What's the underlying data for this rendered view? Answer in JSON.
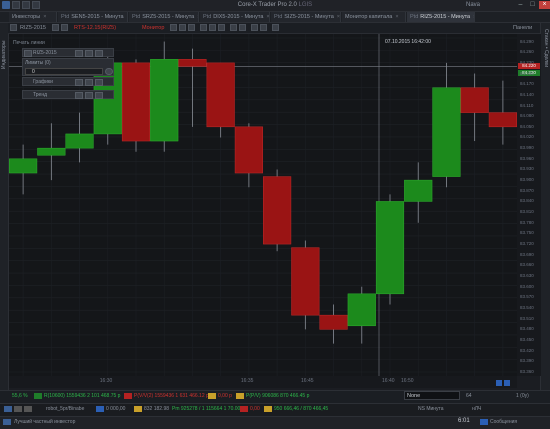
{
  "window": {
    "title": "Core-X Trader Pro 2.0",
    "version": "LGIS",
    "user": "Nava"
  },
  "tabs": [
    {
      "label": "Инвесторы",
      "prefix": "",
      "active": false
    },
    {
      "label": "SEN5-2015 - Минута",
      "prefix": "Ptd",
      "active": false
    },
    {
      "label": "SRZ5-2015 - Минута",
      "prefix": "Ptd",
      "active": false
    },
    {
      "label": "DIX5-2015 - Минута",
      "prefix": "Ptd",
      "active": false
    },
    {
      "label": "SIZ5-2015 - Минута",
      "prefix": "Ptd",
      "active": false
    },
    {
      "label": "Монитор капитала",
      "prefix": "",
      "active": false
    },
    {
      "label": "RIZ5-2015 - Минута",
      "prefix": "Ptd",
      "active": true
    }
  ],
  "toolbar": {
    "symbol": "RIZ5-2015",
    "timeframe": "Минута",
    "red_item_1": "RTS-12.15(RIZ5)",
    "red_item_2": "Монитор",
    "right_label": "Панели"
  },
  "sidebar": {
    "left_label": "Индикаторы",
    "right_label": "Стакан • Сделки"
  },
  "chart_overlay": {
    "hover_time": "07.10.2015 16:42:00",
    "panel_header": "Печать линии",
    "panel1_title": "RIZ5-2015",
    "panel2_title": "Лимиты (0)",
    "panel2_value": "0",
    "panel3_title": "Графики",
    "panel4_title": "Тренд"
  },
  "price_axis": {
    "ticks": [
      "84.290",
      "84.260",
      "84.230",
      "84.200",
      "84.170",
      "84.140",
      "84.110",
      "84.080",
      "84.050",
      "84.020",
      "83.990",
      "83.960",
      "83.930",
      "83.900",
      "83.870",
      "83.840",
      "83.810",
      "83.780",
      "83.750",
      "83.720",
      "83.690",
      "83.660",
      "83.630",
      "83.600",
      "83.570",
      "83.540",
      "83.510",
      "83.480",
      "83.450",
      "83.420",
      "83.390",
      "83.360"
    ],
    "tag_red": "84.220",
    "tag_green": "84.220"
  },
  "time_axis": {
    "ticks": [
      "16:30",
      "16:35",
      "16:40",
      "16:45",
      "16:50"
    ]
  },
  "order_bar": {
    "percent": "55,6 %",
    "field1": "R(10600) 1559436 2 101 468.75 р",
    "field2": "P(V/V(2) 1559436 1 631 466.12 р",
    "field3": "0,00 р",
    "field4": "P(P/V) 906086 870 466.45 р",
    "qty_input": "None",
    "qty_right": "64",
    "qty_units": "1 (0у)"
  },
  "robot_bar": {
    "robot_name": "robot_5pr/Binabe",
    "val1": "0 000,00",
    "val2": "832 182.98",
    "val3": "Pm 925278 / 1 115664 1 70.00%",
    "val4": "0,00",
    "val5": "950 666,46 / 870 466,45",
    "account": "NS Минута",
    "right": "нЛЧ"
  },
  "statusbar": {
    "left": "Лучший частный инвестор",
    "time": "6:01",
    "messages": "Сообщения"
  },
  "chart_data": {
    "type": "candlestick",
    "x": [
      "16:27",
      "16:28",
      "16:29",
      "16:30",
      "16:31",
      "16:32",
      "16:33",
      "16:34",
      "16:35",
      "16:36",
      "16:37",
      "16:38",
      "16:39",
      "16:40",
      "16:41",
      "16:42",
      "16:43",
      "16:44"
    ],
    "open": [
      83.92,
      83.97,
      83.99,
      84.03,
      84.23,
      84.01,
      84.24,
      84.23,
      84.05,
      83.91,
      83.71,
      83.52,
      83.49,
      83.58,
      83.84,
      83.91,
      84.16,
      84.09
    ],
    "close": [
      83.96,
      83.99,
      84.03,
      84.23,
      84.01,
      84.24,
      84.22,
      84.05,
      83.92,
      83.72,
      83.52,
      83.48,
      83.58,
      83.84,
      83.9,
      84.16,
      84.09,
      84.05
    ],
    "high": [
      84.0,
      84.06,
      84.09,
      84.26,
      84.24,
      84.29,
      84.27,
      84.23,
      84.06,
      83.93,
      83.73,
      83.55,
      83.6,
      83.86,
      83.95,
      84.23,
      84.2,
      84.18
    ],
    "low": [
      83.86,
      83.9,
      83.95,
      84.0,
      83.98,
      83.98,
      84.05,
      84.02,
      83.88,
      83.7,
      83.48,
      83.44,
      83.44,
      83.55,
      83.78,
      83.88,
      84.01,
      84.0
    ],
    "ylim": [
      83.36,
      84.3
    ],
    "grid": true
  },
  "colors": {
    "up": "#1c8a1c",
    "down": "#9a1414",
    "accent": "#3a5f95"
  }
}
